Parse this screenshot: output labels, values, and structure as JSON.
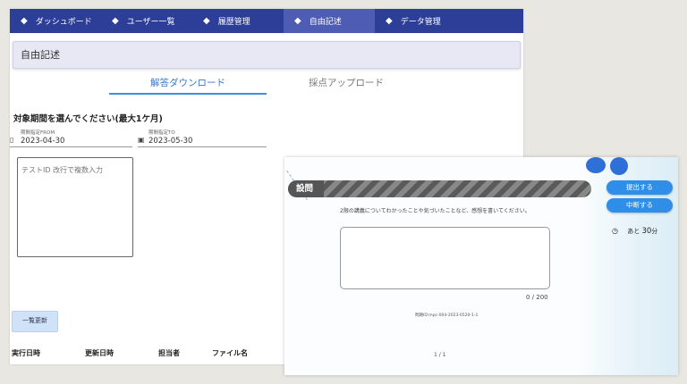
{
  "nav": {
    "items": [
      {
        "label": "ダッシュボード",
        "active": false
      },
      {
        "label": "ユーザー一覧",
        "active": false
      },
      {
        "label": "履歴管理",
        "active": false
      },
      {
        "label": "自由記述",
        "active": true
      },
      {
        "label": "データ管理",
        "active": false
      }
    ]
  },
  "page": {
    "title": "自由記述"
  },
  "tabs": [
    "解答ダウンロード",
    "採点アップロード"
  ],
  "period": {
    "label": "対象期間を選んでください(最大1ケ月)",
    "from_caption": "期間指定FROM",
    "from_value": "2023-04-30",
    "to_caption": "期間指定TO",
    "to_value": "2023-05-30"
  },
  "test_input": {
    "placeholder": "テストID 改行で複数入力"
  },
  "refresh_label": "一覧更新",
  "table_headers": [
    "実行日時",
    "更新日時",
    "担当者",
    "ファイル名"
  ],
  "exam": {
    "question_label": "設問",
    "question_text": "2限の講義についてわかったことや気づいたことなど、感想を書いてください。",
    "counter": "0 / 200",
    "question_id": "問題ID:mpc-004-2023-0520-1-1",
    "pager": "1 / 1",
    "submit_label": "提出する",
    "suspend_label": "中断する",
    "timer_prefix": "あと",
    "timer_value": "30",
    "timer_unit": "分"
  },
  "colors": {
    "nav_bg": "#2d3e99",
    "accent": "#2f8fe8",
    "tab_active": "#3c8fe0"
  }
}
